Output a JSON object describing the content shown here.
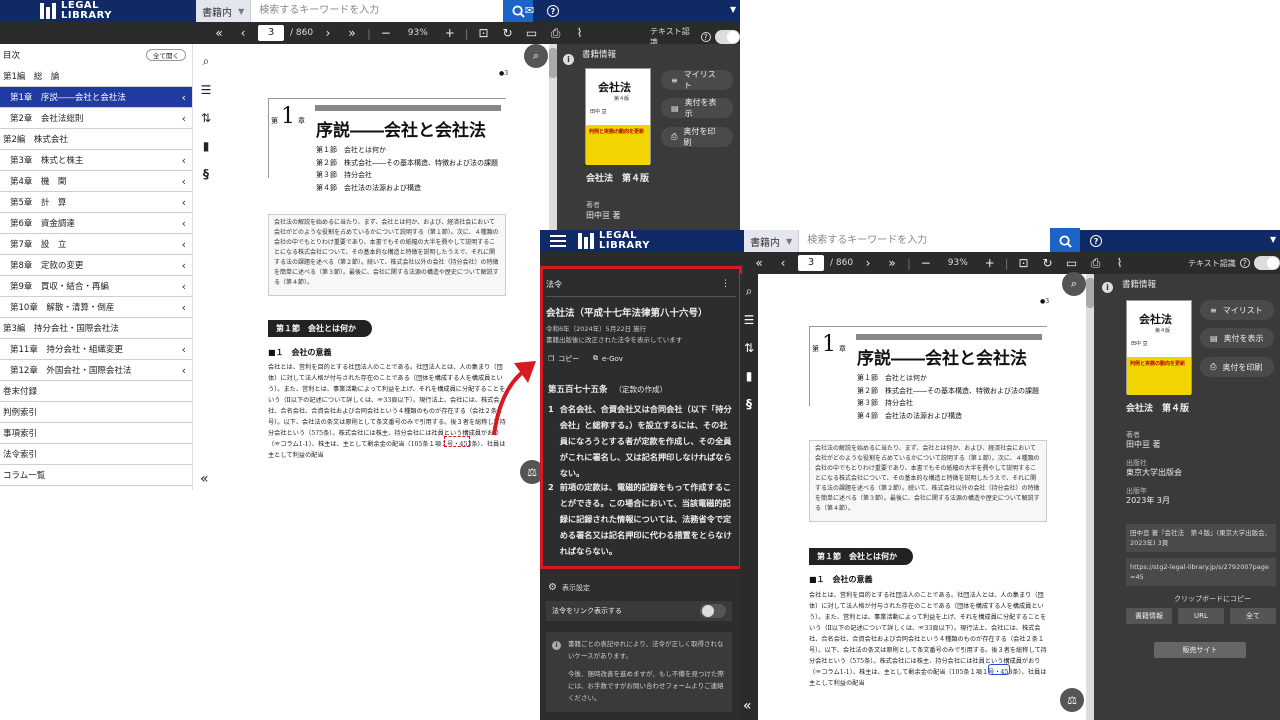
{
  "app": {
    "logo_line1": "LEGAL",
    "logo_line2": "LIBRARY"
  },
  "search": {
    "scope": "書籍内",
    "placeholder": "検索するキーワードを入力"
  },
  "toolbar": {
    "page": "3",
    "total": "/ 860",
    "zoom": "93%",
    "text_recog": "テキスト認識"
  },
  "toc": {
    "title": "目次",
    "expand_all": "全て開く",
    "items": [
      {
        "label": "第1編　総　論",
        "level": 0,
        "chev": false
      },
      {
        "label": "第1章　序説――会社と会社法",
        "level": 1,
        "chev": true,
        "selected": true
      },
      {
        "label": "第2章　会社法総則",
        "level": 1,
        "chev": true
      },
      {
        "label": "第2編　株式会社",
        "level": 0,
        "chev": false
      },
      {
        "label": "第3章　株式と株主",
        "level": 1,
        "chev": true
      },
      {
        "label": "第4章　機　関",
        "level": 1,
        "chev": true
      },
      {
        "label": "第5章　計　算",
        "level": 1,
        "chev": true
      },
      {
        "label": "第6章　資金調達",
        "level": 1,
        "chev": true
      },
      {
        "label": "第7章　設　立",
        "level": 1,
        "chev": true
      },
      {
        "label": "第8章　定款の変更",
        "level": 1,
        "chev": true
      },
      {
        "label": "第9章　買収・結合・再編",
        "level": 1,
        "chev": true
      },
      {
        "label": "第10章　解散・清算・倒産",
        "level": 1,
        "chev": true
      },
      {
        "label": "第3編　持分会社・国際会社法",
        "level": 0,
        "chev": false
      },
      {
        "label": "第11章　持分会社・組織変更",
        "level": 1,
        "chev": true
      },
      {
        "label": "第12章　外国会社・国際会社法",
        "level": 1,
        "chev": true
      },
      {
        "label": "巻末付録",
        "level": 0,
        "chev": false
      },
      {
        "label": "判例索引",
        "level": 0,
        "chev": false
      },
      {
        "label": "事項索引",
        "level": 0,
        "chev": false
      },
      {
        "label": "法令索引",
        "level": 0,
        "chev": false
      },
      {
        "label": "コラム一覧",
        "level": 0,
        "chev": false
      }
    ]
  },
  "doc": {
    "page_mark": "●3",
    "chapter_num": "1",
    "chapter_suffix": "章",
    "chapter_prefix": "第",
    "chapter_title": "序説――会社と会社法",
    "sections": [
      "第１節　会社とは何か",
      "第２節　株式会社――その基本構造、特徴および法の課題",
      "第３節　持分会社",
      "第４節　会社法の法源および構造"
    ],
    "intro": "会社法の解説を始めるに当たり、まず、会社とは何か、および、経済社会において会社がどのような役割を占めているかについて説明する（第１節）。次に、４種類の会社の中でもとりわけ重要であり、本書でもその紙幅の大半を費やして説明することになる株式会社について、その基本的な構造と特徴を説明したうえで、それに関する法の課題を述べる（第２節）。続いて、株式会社以外の会社（持分会社）の特徴を簡単に述べる（第３節）。最後に、会社に関する法源の構造や歴史について解説する（第４節）。",
    "sec_head": "第１節　会社とは何か",
    "sub_head": "■１　会社の意義",
    "body": "会社とは、営利を目的とする社団法人のことである。社団法人とは、人の集まり（団体）に対して法人格が付与された存在のことである（団体を構成する人を構成員という）。また、営利とは、事業活動によって利益を上げ、それを構成員に分配することをいう（Ⅱ以下の記述について詳しくは、☞33頁以下）。現行法上、会社には、株式会社、合名会社、合資会社および合同会社という４種類のものが存在する（会社２条１号）。以下、会社法の条文は原則として条文番号のみで引用する。後３者を総称して持分会社という（575条）。株式会社には株主、持分会社には社員という構成員がおり（☞コラム1-1）、株主は、主として剰余金の配当（105条１項１号・453条）、社員は主として利益の配当"
  },
  "info": {
    "title": "書籍情報",
    "cover_title": "会社法",
    "cover_ed": "第４版",
    "cover_author": "田中 亘",
    "cover_band": "判例と実務の動向を更新",
    "buttons": [
      "マイリスト",
      "奥付を表示",
      "奥付を印刷"
    ],
    "book_title": "会社法　第４版",
    "author_label": "著者",
    "author": "田中亘 著",
    "publisher_label": "出版社",
    "publisher": "東京大学出版会",
    "date_label": "出版年",
    "date": "2023年 3月",
    "citation": "田中亘 著『会社法　第４版』(東京大学出版会、2023年) 3頁",
    "url": "https://stg2-legal-library.jp/s/2792007page=45",
    "clipboard": "クリップボードにコピー",
    "copy_btns": [
      "書籍情報",
      "URL",
      "全て"
    ],
    "sales": "販売サイト"
  },
  "law": {
    "header": "法令",
    "name": "会社法（平成十七年法律第八十六号）",
    "effective": "令和6年（2024年）5月22日 施行",
    "note": "書籍出版後に改正された法令を表示しています",
    "copy": "コピー",
    "egov": "e-Gov",
    "article": "第五百七十五条",
    "article_caption": "（定款の作成）",
    "para1_num": "1",
    "para1": "合名会社、合資会社又は合同会社（以下「持分会社」と総称する。）を設立するには、その社員になろうとする者が定款を作成し、その全員がこれに署名し、又は記名押印しなければならない。",
    "para2_num": "2",
    "para2": "前項の定款は、電磁的記録をもって作成することができる。この場合において、当該電磁的記録に記録された情報については、法務省令で定める署名又は記名押印に代わる措置をとらなければならない。",
    "settings": "表示設定",
    "link_toggle": "法令をリンク表示する",
    "disclaimer": "書籍ごとの表記ゆれにより、法令が正しく取得されないケースがあります。",
    "contact": "今後、随時改善を進めますが、もし不備を見つけた際には、お手数ですがお問い合わせフォームよりご連絡ください。"
  },
  "colors": {
    "navy": "#102a66",
    "red": "#d71920",
    "selected": "#1f3aa0"
  }
}
